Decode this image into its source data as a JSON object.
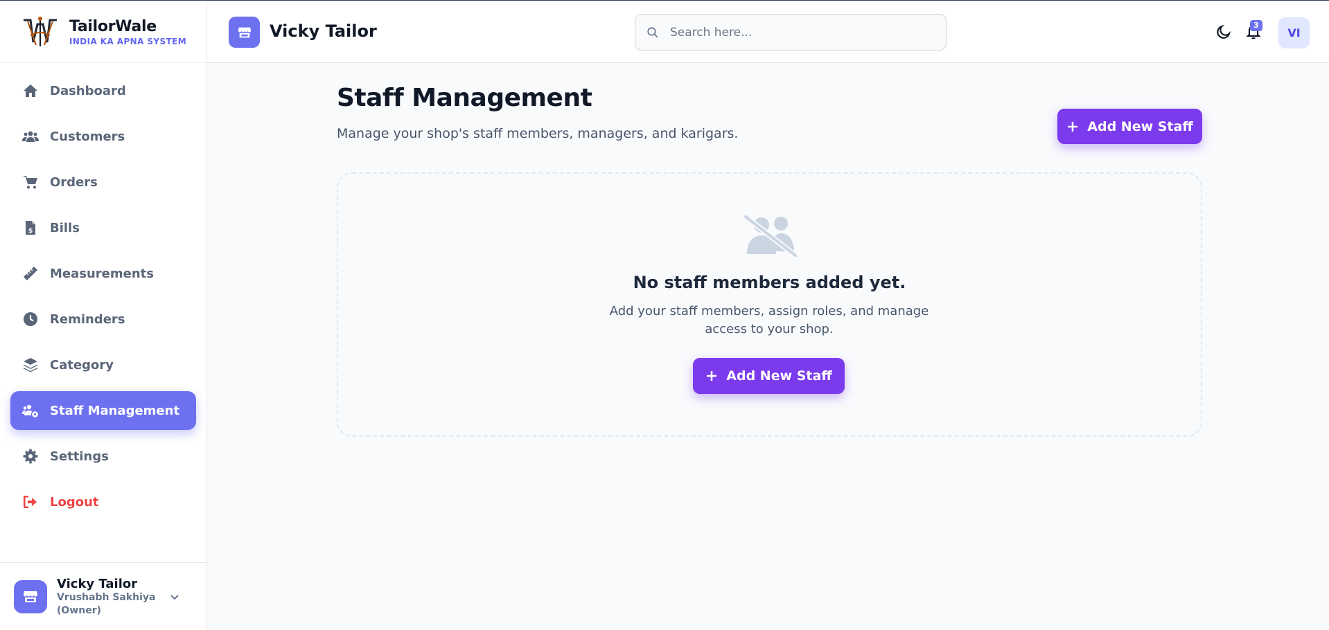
{
  "brand": {
    "name": "TailorWale",
    "tagline": "INDIA KA APNA SYSTEM"
  },
  "sidebar": {
    "items": [
      {
        "label": "Dashboard",
        "icon": "home-icon"
      },
      {
        "label": "Customers",
        "icon": "users-icon"
      },
      {
        "label": "Orders",
        "icon": "cart-icon"
      },
      {
        "label": "Bills",
        "icon": "bill-icon"
      },
      {
        "label": "Measurements",
        "icon": "ruler-icon"
      },
      {
        "label": "Reminders",
        "icon": "clock-icon"
      },
      {
        "label": "Category",
        "icon": "layers-icon"
      },
      {
        "label": "Staff Management",
        "icon": "staff-gear-icon",
        "active": true
      },
      {
        "label": "Settings",
        "icon": "gear-icon"
      }
    ],
    "logout_label": "Logout",
    "footer": {
      "shop_name": "Vicky Tailor",
      "owner": "Vrushabh Sakhiya (Owner)"
    }
  },
  "header": {
    "title": "Vicky Tailor",
    "search_placeholder": "Search here...",
    "notification_count": "3",
    "user_initials": "VI"
  },
  "main": {
    "title": "Staff Management",
    "subtitle": "Manage your shop's staff members, managers, and karigars.",
    "add_button_label": "Add New Staff",
    "empty_state": {
      "title": "No staff members added yet.",
      "text": "Add your staff members, assign roles, and manage access to your shop.",
      "button_label": "Add New Staff"
    }
  },
  "colors": {
    "accent": "#6d71f0",
    "primary_button": "#7c3aed",
    "danger": "#ef4444"
  }
}
